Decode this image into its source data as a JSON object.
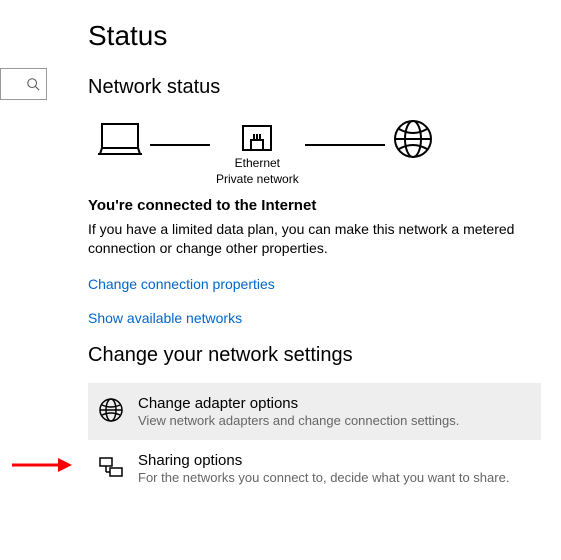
{
  "page": {
    "title": "Status"
  },
  "network_status": {
    "heading": "Network status",
    "connection": {
      "name": "Ethernet",
      "type": "Private network"
    },
    "connected_title": "You're connected to the Internet",
    "connected_desc": "If you have a limited data plan, you can make this network a metered connection or change other properties.",
    "link_change_props": "Change connection properties",
    "link_show_networks": "Show available networks"
  },
  "settings": {
    "heading": "Change your network settings",
    "items": [
      {
        "title": "Change adapter options",
        "sub": "View network adapters and change connection settings."
      },
      {
        "title": "Sharing options",
        "sub": "For the networks you connect to, decide what you want to share."
      }
    ]
  },
  "colors": {
    "link": "#0066cc",
    "highlight": "#eeeeee",
    "arrow": "#ff0000"
  }
}
